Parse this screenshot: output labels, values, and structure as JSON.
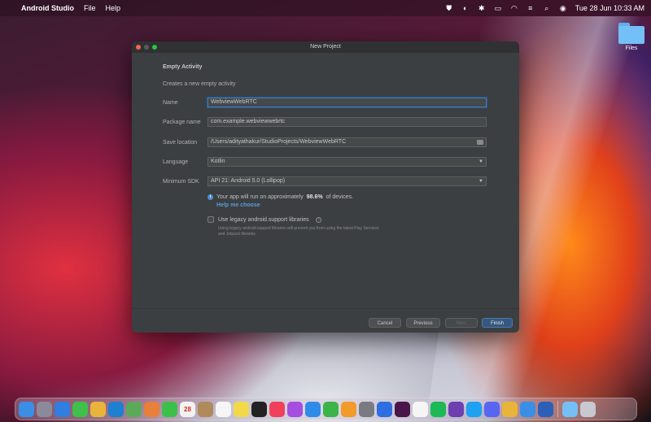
{
  "menubar": {
    "app_name": "Android Studio",
    "menus": [
      "File",
      "Help"
    ],
    "clock": "Tue 28 Jun  10:33 AM"
  },
  "desktop": {
    "folder_label": "Files"
  },
  "dialog": {
    "title": "New Project",
    "section_title": "Empty Activity",
    "subtitle": "Creates a new empty activity",
    "fields": {
      "name_label": "Name",
      "name_value": "WebviewWebRTC",
      "package_label": "Package name",
      "package_value": "com.example.webviewwebrtc",
      "save_label": "Save location",
      "save_value": "/Users/adityathakur/StudioProjects/WebviewWebRTC",
      "language_label": "Language",
      "language_value": "Kotlin",
      "sdk_label": "Minimum SDK",
      "sdk_value": "API 21: Android 5.0 (Lollipop)"
    },
    "info": {
      "prefix": "Your app will run on approximately",
      "percent": "98.6%",
      "suffix": "of devices.",
      "help_link": "Help me choose"
    },
    "legacy": {
      "label": "Use legacy android.support libraries",
      "checked": false,
      "note": "Using legacy android.support libraries will prevent you from using the latest Play Services and Jetpack libraries"
    },
    "buttons": {
      "cancel": "Cancel",
      "previous": "Previous",
      "next": "Next",
      "finish": "Finish"
    }
  },
  "colors": {
    "dialog_bg": "#3c3f41",
    "accent": "#365880",
    "focus": "#3d7bbf",
    "link": "#5b9bd8"
  },
  "dock": {
    "calendar_day": "28",
    "items": [
      {
        "name": "finder-icon",
        "color": "#3a8ee6",
        "glyph": ""
      },
      {
        "name": "launchpad-icon",
        "color": "#8a8a9a",
        "glyph": ""
      },
      {
        "name": "safari-icon",
        "color": "#2f7ee0",
        "glyph": ""
      },
      {
        "name": "messages-icon",
        "color": "#3ec04a",
        "glyph": ""
      },
      {
        "name": "chrome-icon",
        "color": "#e9b43a",
        "glyph": ""
      },
      {
        "name": "vscode-icon",
        "color": "#1f7fd0",
        "glyph": ""
      },
      {
        "name": "maps-icon",
        "color": "#5aaa5a",
        "glyph": ""
      },
      {
        "name": "photos-icon",
        "color": "#e87f3a",
        "glyph": ""
      },
      {
        "name": "facetime-icon",
        "color": "#3cc04a",
        "glyph": ""
      },
      {
        "name": "calendar-icon",
        "color": "#f2f2f2",
        "glyph": "28"
      },
      {
        "name": "contacts-icon",
        "color": "#b08a5a",
        "glyph": ""
      },
      {
        "name": "reminders-icon",
        "color": "#f5f5f5",
        "glyph": ""
      },
      {
        "name": "notes-icon",
        "color": "#f3d94a",
        "glyph": ""
      },
      {
        "name": "appletv-icon",
        "color": "#222222",
        "glyph": ""
      },
      {
        "name": "music-icon",
        "color": "#f0405a",
        "glyph": ""
      },
      {
        "name": "podcasts-icon",
        "color": "#a64ee0",
        "glyph": ""
      },
      {
        "name": "appstore-icon",
        "color": "#2f8be8",
        "glyph": ""
      },
      {
        "name": "numbers-icon",
        "color": "#3cb44a",
        "glyph": ""
      },
      {
        "name": "pages-icon",
        "color": "#f29a2a",
        "glyph": ""
      },
      {
        "name": "settings-icon",
        "color": "#7a7a82",
        "glyph": ""
      },
      {
        "name": "xcode-icon",
        "color": "#2f6ee0",
        "glyph": ""
      },
      {
        "name": "slack-icon",
        "color": "#4a154b",
        "glyph": ""
      },
      {
        "name": "notion-icon",
        "color": "#f5f5f5",
        "glyph": ""
      },
      {
        "name": "spotify-icon",
        "color": "#1db954",
        "glyph": ""
      },
      {
        "name": "github-icon",
        "color": "#6e3fb0",
        "glyph": ""
      },
      {
        "name": "twitter-icon",
        "color": "#1da1f2",
        "glyph": ""
      },
      {
        "name": "discord-icon",
        "color": "#5865f2",
        "glyph": ""
      },
      {
        "name": "chrome2-icon",
        "color": "#e9b43a",
        "glyph": ""
      },
      {
        "name": "chrome3-icon",
        "color": "#3a8ee6",
        "glyph": ""
      },
      {
        "name": "word-icon",
        "color": "#2b5fb8",
        "glyph": ""
      }
    ],
    "right_items": [
      {
        "name": "downloads-folder-icon",
        "color": "#74bff5",
        "glyph": ""
      },
      {
        "name": "trash-icon",
        "color": "#c8c8d0",
        "glyph": ""
      }
    ]
  }
}
